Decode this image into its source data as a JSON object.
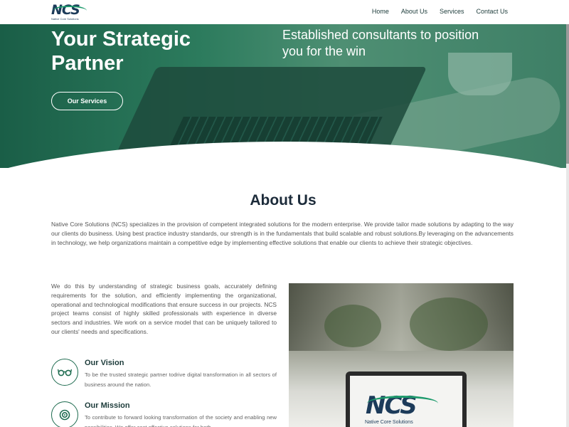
{
  "brand": {
    "logo_text": "NCS",
    "logo_tagline": "Native Core Solutions"
  },
  "nav": {
    "items": [
      {
        "label": "Home"
      },
      {
        "label": "About Us"
      },
      {
        "label": "Services"
      },
      {
        "label": "Contact Us"
      }
    ]
  },
  "hero": {
    "title": "Your Strategic Partner",
    "subtitle": "Established consultants to position you for the win",
    "button_label": "Our Services"
  },
  "about": {
    "title": "About Us",
    "intro": "Native Core Solutions (NCS) specializes in the provision of competent integrated solutions for the modern enterprise. We provide tailor made solutions by adapting to the way our clients do business. Using best practice industry standards, our strength is in the fundamentals that build scalable and robust solutions.By leveraging on the advancements in technology, we help organizations maintain a competitive edge by implementing effective solutions that enable our clients to achieve their strategic objectives.",
    "detail": "We do this by understanding of strategic business goals, accurately defining requirements for the solution, and efficiently implementing the organizational, operational and technological modifications that ensure success in our projects. NCS project teams consist of highly skilled professionals with experience in diverse sectors and industries. We work on a service model that can be uniquely tailored to our clients' needs and specifications.",
    "vision": {
      "title": "Our Vision",
      "text": "To be the trusted strategic partner todrive digital transformation in all sectors of business around the nation.",
      "icon": "glasses-icon"
    },
    "mission": {
      "title": "Our Mission",
      "text": "To contribute to forward looking transformation of the society and enabling new possibilities. We offer cost effective solutions for both",
      "icon": "target-icon"
    }
  },
  "photo": {
    "logo_text": "NCS",
    "logo_tagline": "Native Core Solutions"
  },
  "colors": {
    "brand_green": "#1d6b4f",
    "brand_navy": "#1c3b5a",
    "accent_green": "#1d9a6c"
  }
}
